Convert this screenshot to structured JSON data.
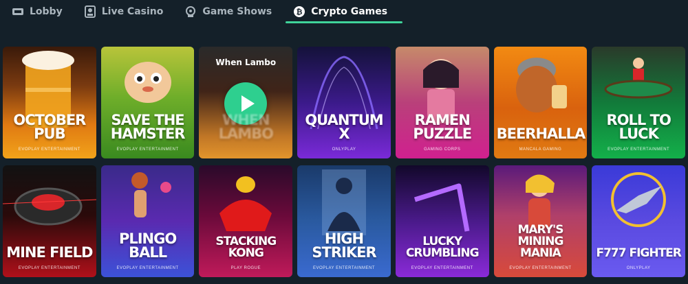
{
  "nav": {
    "tabs": [
      {
        "label": "Lobby",
        "icon": "lobby-icon",
        "active": false
      },
      {
        "label": "Live Casino",
        "icon": "live-casino-icon",
        "active": false
      },
      {
        "label": "Game Shows",
        "icon": "game-shows-icon",
        "active": false
      },
      {
        "label": "Crypto Games",
        "icon": "crypto-icon",
        "active": true
      }
    ],
    "accent_color": "#3fd39a"
  },
  "games": {
    "row1": [
      {
        "title": "October Pub",
        "provider": "Evoplay Entertainment"
      },
      {
        "title": "Save the Hamster",
        "provider": "Evoplay Entertainment"
      },
      {
        "title": "When Lambo",
        "provider": "",
        "hover": true
      },
      {
        "title": "Quantum X",
        "provider": "Onlyplay"
      },
      {
        "title": "Ramen Puzzle",
        "provider": "Gaming Corps"
      },
      {
        "title": "Beerhalla",
        "provider": "Mancala Gaming"
      },
      {
        "title": "Roll to Luck",
        "provider": "Evoplay Entertainment"
      }
    ],
    "row2": [
      {
        "title": "Mine Field",
        "provider": "Evoplay Entertainment"
      },
      {
        "title": "Plingo Ball",
        "provider": "Evoplay Entertainment"
      },
      {
        "title": "Stacking Kong",
        "provider": "Play Rogue"
      },
      {
        "title": "High Striker",
        "provider": "Evoplay Entertainment"
      },
      {
        "title": "Lucky Crumbling",
        "provider": "Evoplay Entertainment"
      },
      {
        "title": "Mary's Mining Mania",
        "provider": "Evoplay Entertainment"
      },
      {
        "title": "F777 Fighter",
        "provider": "Onlyplay"
      }
    ]
  }
}
